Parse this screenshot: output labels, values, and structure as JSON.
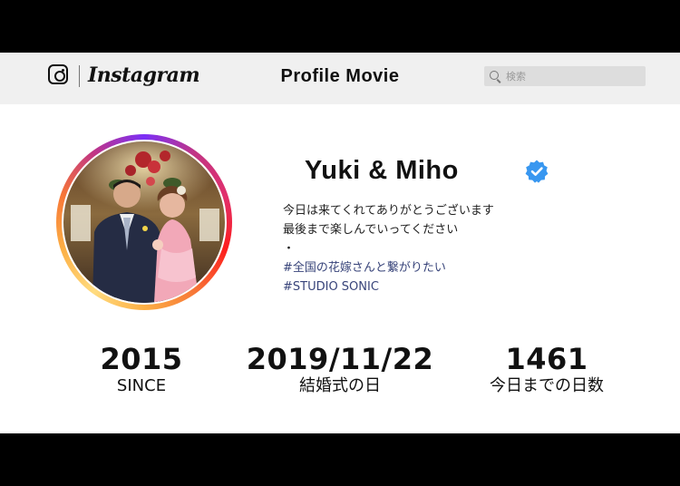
{
  "header": {
    "brand": "Instagram",
    "title": "Profile Movie",
    "search_placeholder": "検索"
  },
  "profile": {
    "username": "Yuki & Miho",
    "verified": true,
    "bio": [
      "今日は来てくれてありがとうございます",
      "最後まで楽しんでいってください",
      "・"
    ],
    "hashtags": [
      "#全国の花嫁さんと繋がりたい",
      "#STUDIO SONIC"
    ]
  },
  "stats": [
    {
      "value": "2015",
      "label": "SINCE"
    },
    {
      "value": "2019/11/22",
      "label": "結婚式の日"
    },
    {
      "value": "1461",
      "label": "今日までの日数"
    }
  ],
  "colors": {
    "hashtag": "#38447a",
    "verified_badge": "#3897f0",
    "topbar": "#f0f0f0"
  }
}
